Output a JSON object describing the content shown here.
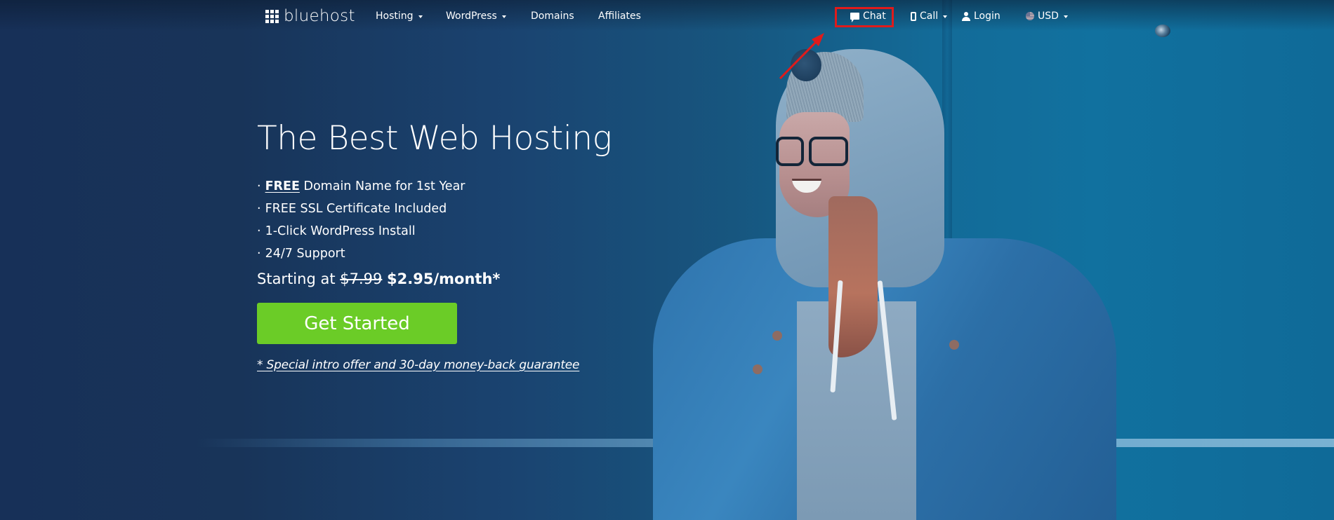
{
  "brand": {
    "name": "bluehost",
    "logo_icon": "grid-icon"
  },
  "nav": {
    "left_items": [
      {
        "label": "Hosting",
        "has_dropdown": true
      },
      {
        "label": "WordPress",
        "has_dropdown": true
      },
      {
        "label": "Domains",
        "has_dropdown": false
      },
      {
        "label": "Affiliates",
        "has_dropdown": false
      }
    ],
    "right_items": [
      {
        "label": "Chat",
        "icon": "chat-icon",
        "has_dropdown": false,
        "highlighted": true
      },
      {
        "label": "Call",
        "icon": "phone-icon",
        "has_dropdown": true
      },
      {
        "label": "Login",
        "icon": "user-icon",
        "has_dropdown": false
      },
      {
        "label": "USD",
        "icon": "us-flag-icon",
        "has_dropdown": true
      }
    ]
  },
  "hero": {
    "title": "The Best Web Hosting",
    "features": [
      {
        "bullet": "·",
        "emphasis": "FREE",
        "text": " Domain Name for 1st Year"
      },
      {
        "bullet": "·",
        "emphasis": "",
        "text": "FREE SSL Certificate Included"
      },
      {
        "bullet": "·",
        "emphasis": "",
        "text": "1-Click WordPress Install"
      },
      {
        "bullet": "·",
        "emphasis": "",
        "text": "24/7 Support"
      }
    ],
    "pricing": {
      "prefix": "Starting at ",
      "old_price": "$7.99",
      "new_price": "$2.95/month*"
    },
    "cta_label": "Get Started",
    "disclaimer": "* Special intro offer and 30-day money-back guarantee"
  },
  "annotation": {
    "highlight_target": "Chat",
    "highlight_color": "#e01b1b"
  },
  "colors": {
    "cta_green": "#6bcc27",
    "hero_dark_blue": "#173058",
    "hero_light_blue": "#11719f"
  }
}
